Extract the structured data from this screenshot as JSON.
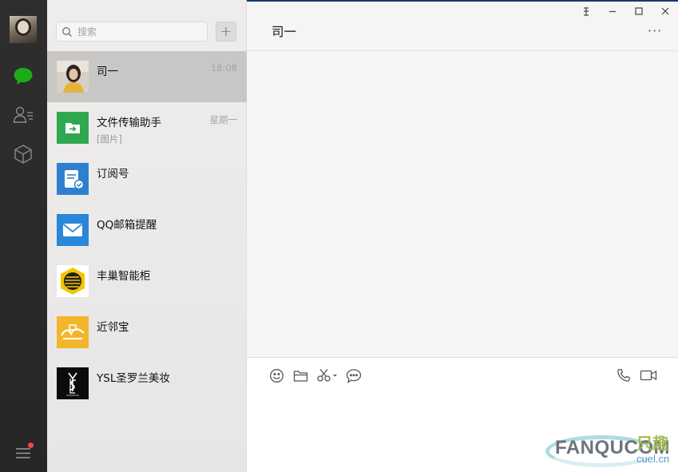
{
  "window": {
    "pin": "平",
    "minimize": "–",
    "maximize": "☐",
    "close": "✕"
  },
  "search": {
    "placeholder": "搜索",
    "add_label": "+"
  },
  "chats": [
    {
      "name": "司一",
      "time": "18:08",
      "preview": ""
    },
    {
      "name": "文件传输助手",
      "time": "星期一",
      "preview": "[图片]"
    },
    {
      "name": "订阅号",
      "time": "",
      "preview": ""
    },
    {
      "name": "QQ邮箱提醒",
      "time": "",
      "preview": ""
    },
    {
      "name": "丰巢智能柜",
      "time": "",
      "preview": ""
    },
    {
      "name": "近邻宝",
      "time": "",
      "preview": ""
    },
    {
      "name": "YSL圣罗兰美妆",
      "time": "",
      "preview": ""
    }
  ],
  "conversation": {
    "title": "司一",
    "more": "···"
  },
  "watermark": {
    "brand": "FANQU",
    "brand_tail": "COM",
    "cn": "只趣",
    "domain": "cuel.cn"
  },
  "colors": {
    "accent_green": "#1aad19",
    "rail": "#2b2b2b",
    "list_bg": "#ebeaea",
    "selected": "#c8c7c6",
    "badge_red": "#f04a3c"
  }
}
